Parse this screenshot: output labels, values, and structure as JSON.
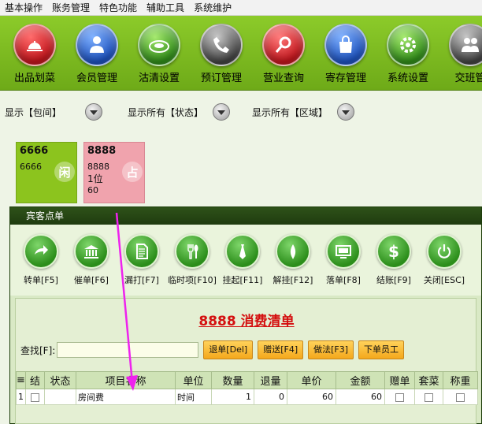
{
  "menu": [
    "基本操作",
    "账务管理",
    "特色功能",
    "辅助工具",
    "系统维护"
  ],
  "toolbar": [
    {
      "label": "出品划菜",
      "icon": "serving-cloche-icon",
      "color": "#d6262b"
    },
    {
      "label": "会员管理",
      "icon": "member-icon",
      "color": "#2a62c9"
    },
    {
      "label": "沽清设置",
      "icon": "plate-icon",
      "color": "#3d9a25"
    },
    {
      "label": "预订管理",
      "icon": "phone-icon",
      "color": "#6a6a6a"
    },
    {
      "label": "营业查询",
      "icon": "magnifier-icon",
      "color": "#d6262b"
    },
    {
      "label": "寄存管理",
      "icon": "bag-icon",
      "color": "#2a62c9"
    },
    {
      "label": "系统设置",
      "icon": "gear-icon",
      "color": "#3d9a25"
    },
    {
      "label": "交班管",
      "icon": "staff-icon",
      "color": "#6a6a6a"
    }
  ],
  "filters": [
    "显示【包间】",
    "显示所有【状态】",
    "显示所有【区域】"
  ],
  "rooms": [
    {
      "number": "6666",
      "name": "6666",
      "tag": "闲",
      "guests": "",
      "amount": ""
    },
    {
      "number": "8888",
      "name": "8888",
      "tag": "占",
      "guests": "1位",
      "amount": "60"
    }
  ],
  "dialog": {
    "title": "宾客点单",
    "buttons": [
      {
        "label": "转单[F5]",
        "icon": "arrow-right-icon"
      },
      {
        "label": "催单[F6]",
        "icon": "bank-icon"
      },
      {
        "label": "漏打[F7]",
        "icon": "document-icon"
      },
      {
        "label": "临时项[F10]",
        "icon": "cutlery-icon"
      },
      {
        "label": "挂起[F11]",
        "icon": "tie-icon"
      },
      {
        "label": "解挂[F12]",
        "icon": "pen-icon"
      },
      {
        "label": "落单[F8]",
        "icon": "screen-icon"
      },
      {
        "label": "结账[F9]",
        "icon": "dollar-icon"
      },
      {
        "label": "关闭[ESC]",
        "icon": "power-icon"
      }
    ],
    "bill_title": "8888  消费清单",
    "search_label": "查找[F]:",
    "search_value": "",
    "action_buttons": [
      "退单[Del]",
      "赠送[F4]",
      "做法[F3]",
      "下单员工"
    ],
    "columns": [
      "",
      "结",
      "状态",
      "项目名称",
      "单位",
      "数量",
      "退量",
      "单价",
      "金额",
      "赠单",
      "套菜",
      "称重"
    ],
    "rows": [
      {
        "index": "1",
        "status": "",
        "name": "房间费",
        "unit": "时间",
        "qty": "1",
        "ret": "0",
        "price": "60",
        "amount": "60"
      }
    ]
  }
}
